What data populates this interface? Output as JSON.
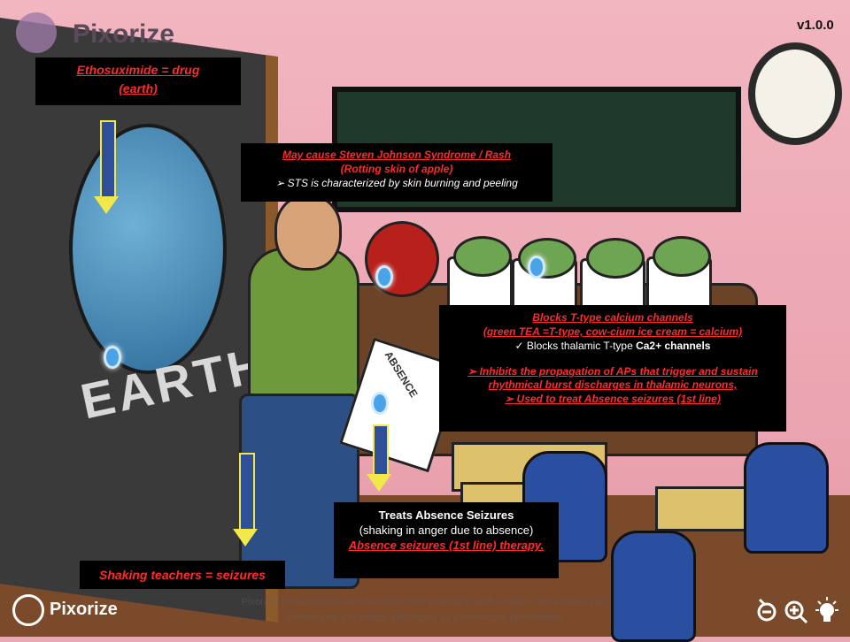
{
  "brand": {
    "top_logo": "Pixorize",
    "bottom_logo": "Pixorize",
    "version": "v1.0.0"
  },
  "scene": {
    "earth_label": "EARTH",
    "clipboard_label": "ABSENCE"
  },
  "boxes": {
    "ethosuximide": {
      "line1": "Ethosuximide = drug",
      "line2": "(earth)"
    },
    "sjs": {
      "line1": "May cause Steven Johnson  Syndrome / Rash",
      "line2": "(Rotting skin of apple)",
      "bullet": "STS is characterized by skin burning and peeling"
    },
    "ttype": {
      "line1": "Blocks T-type calcium channels",
      "line2": "(green TEA =T-type, cow-cium ice cream = calcium)",
      "check_prefix": "Blocks thalamic T-type ",
      "check_bold": "Ca2+ channels",
      "arrow1": "Inhibits the propagation of APs that trigger and sustain rhythmical burst discharges in thalamic neurons,",
      "arrow2": "Used to treat Absence seizures (1st line)"
    },
    "treats": {
      "line1": "Treats Absence Seizures",
      "line2": "(shaking in anger due to absence)",
      "line3": "Absence seizures (1st line) therapy."
    },
    "shaking": {
      "line1": "Shaking teachers = seizures"
    }
  },
  "footer": {
    "watermark": "Pixorize. Unauthorized reproduction of this material is both unlawful and violates your professional and ethical obligations as a healthcare professional."
  },
  "toolbar": {
    "zoom_out_icon": "zoom-out-icon",
    "zoom_in_icon": "zoom-in-icon",
    "hint_icon": "lightbulb-icon"
  },
  "colors": {
    "box_bg": "#000000",
    "accent_red": "#ff2a2a",
    "arrow_yellow": "#f2e84a",
    "arrow_blue": "#2f4f98",
    "hotspot": "#4aa3e6"
  }
}
